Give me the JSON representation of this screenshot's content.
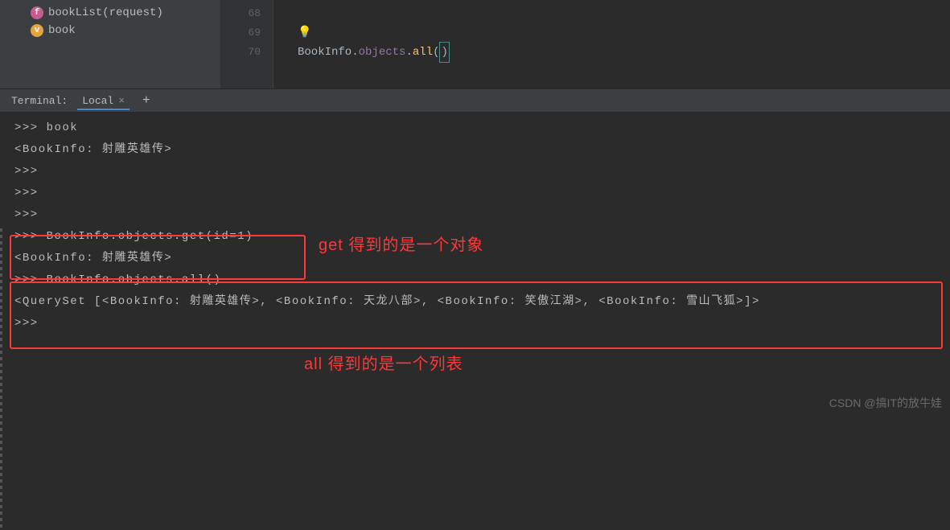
{
  "sidebar": {
    "items": [
      {
        "badge": "f",
        "label": "bookList(request)"
      },
      {
        "badge": "v",
        "label": "book"
      }
    ]
  },
  "editor": {
    "gutter": [
      "68",
      "69",
      "70"
    ],
    "code70": {
      "class": "BookInfo",
      "dot1": ".",
      "objects": "objects",
      "dot2": ".",
      "all": "all",
      "p1": "(",
      "p2": ")"
    }
  },
  "terminal": {
    "header_label": "Terminal:",
    "tab_name": "Local",
    "lines": [
      ">>> book",
      "<BookInfo: 射雕英雄传>",
      ">>>",
      ">>>",
      ">>>",
      "",
      ">>> BookInfo.objects.get(id=1)",
      "<BookInfo: 射雕英雄传>",
      ">>> BookInfo.objects.all()",
      "<QuerySet [<BookInfo: 射雕英雄传>, <BookInfo: 天龙八部>, <BookInfo: 笑傲江湖>, <BookInfo: 雪山飞狐>]>",
      ">>>"
    ]
  },
  "annotations": {
    "get": "get 得到的是一个对象",
    "all": "all 得到的是一个列表"
  },
  "watermark": "CSDN @搞IT的放牛娃"
}
